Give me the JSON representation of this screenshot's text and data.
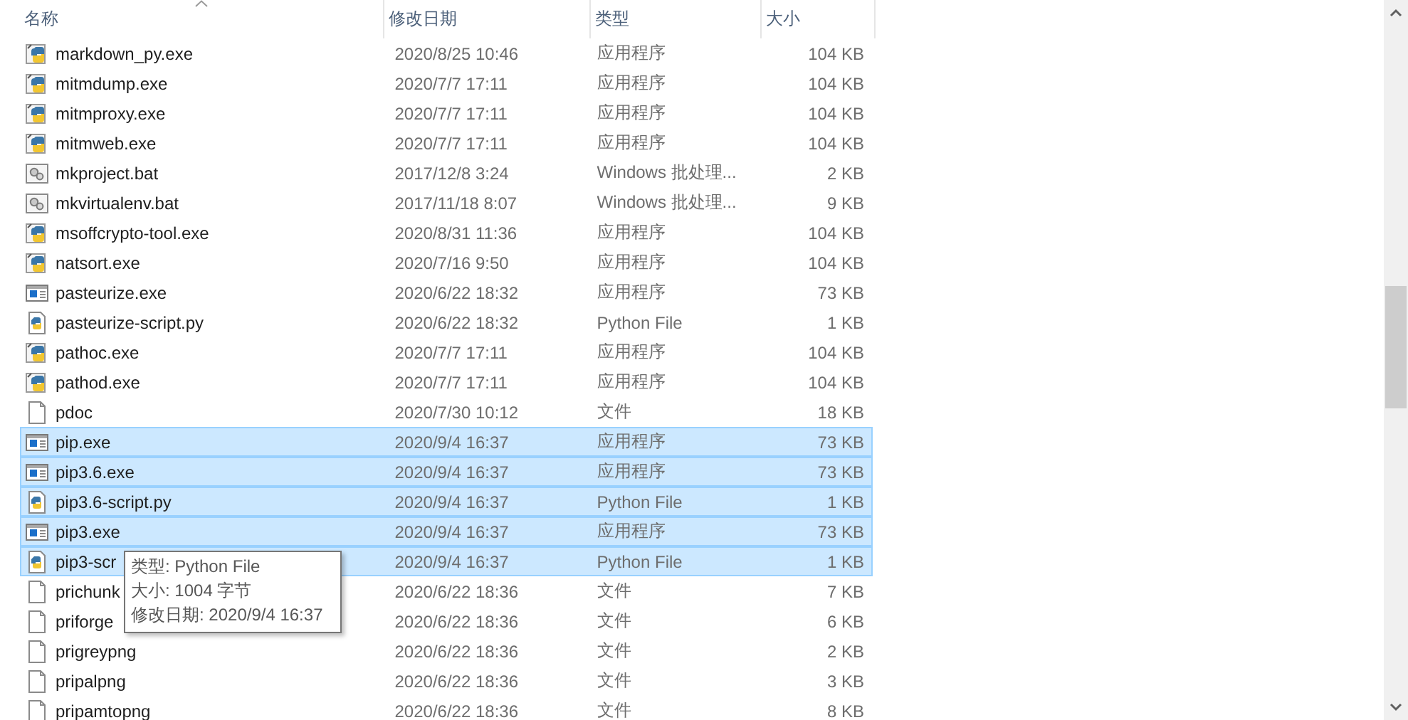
{
  "columns": [
    {
      "label": "名称",
      "sorted": true
    },
    {
      "label": "修改日期",
      "sorted": false
    },
    {
      "label": "类型",
      "sorted": false
    },
    {
      "label": "大小",
      "sorted": false
    }
  ],
  "rows": [
    {
      "kind": "pyapp",
      "name": "markdown_py.exe",
      "date": "2020/8/25 10:46",
      "type": "应用程序",
      "size": "104 KB",
      "selected": false
    },
    {
      "kind": "pyapp",
      "name": "mitmdump.exe",
      "date": "2020/7/7 17:11",
      "type": "应用程序",
      "size": "104 KB",
      "selected": false
    },
    {
      "kind": "pyapp",
      "name": "mitmproxy.exe",
      "date": "2020/7/7 17:11",
      "type": "应用程序",
      "size": "104 KB",
      "selected": false
    },
    {
      "kind": "pyapp",
      "name": "mitmweb.exe",
      "date": "2020/7/7 17:11",
      "type": "应用程序",
      "size": "104 KB",
      "selected": false
    },
    {
      "kind": "bat",
      "name": "mkproject.bat",
      "date": "2017/12/8 3:24",
      "type": "Windows 批处理...",
      "size": "2 KB",
      "selected": false
    },
    {
      "kind": "bat",
      "name": "mkvirtualenv.bat",
      "date": "2017/11/18 8:07",
      "type": "Windows 批处理...",
      "size": "9 KB",
      "selected": false
    },
    {
      "kind": "pyapp",
      "name": "msoffcrypto-tool.exe",
      "date": "2020/8/31 11:36",
      "type": "应用程序",
      "size": "104 KB",
      "selected": false
    },
    {
      "kind": "pyapp",
      "name": "natsort.exe",
      "date": "2020/7/16 9:50",
      "type": "应用程序",
      "size": "104 KB",
      "selected": false
    },
    {
      "kind": "exe",
      "name": "pasteurize.exe",
      "date": "2020/6/22 18:32",
      "type": "应用程序",
      "size": "73 KB",
      "selected": false
    },
    {
      "kind": "pyscript",
      "name": "pasteurize-script.py",
      "date": "2020/6/22 18:32",
      "type": "Python File",
      "size": "1 KB",
      "selected": false
    },
    {
      "kind": "pyapp",
      "name": "pathoc.exe",
      "date": "2020/7/7 17:11",
      "type": "应用程序",
      "size": "104 KB",
      "selected": false
    },
    {
      "kind": "pyapp",
      "name": "pathod.exe",
      "date": "2020/7/7 17:11",
      "type": "应用程序",
      "size": "104 KB",
      "selected": false
    },
    {
      "kind": "file",
      "name": "pdoc",
      "date": "2020/7/30 10:12",
      "type": "文件",
      "size": "18 KB",
      "selected": false
    },
    {
      "kind": "exe",
      "name": "pip.exe",
      "date": "2020/9/4 16:37",
      "type": "应用程序",
      "size": "73 KB",
      "selected": true
    },
    {
      "kind": "exe",
      "name": "pip3.6.exe",
      "date": "2020/9/4 16:37",
      "type": "应用程序",
      "size": "73 KB",
      "selected": true
    },
    {
      "kind": "pyscript",
      "name": "pip3.6-script.py",
      "date": "2020/9/4 16:37",
      "type": "Python File",
      "size": "1 KB",
      "selected": true
    },
    {
      "kind": "exe",
      "name": "pip3.exe",
      "date": "2020/9/4 16:37",
      "type": "应用程序",
      "size": "73 KB",
      "selected": true
    },
    {
      "kind": "pyscript",
      "name": "pip3-scr",
      "date": "2020/9/4 16:37",
      "type": "Python File",
      "size": "1 KB",
      "selected": true
    },
    {
      "kind": "file",
      "name": "prichunk",
      "date": "2020/6/22 18:36",
      "type": "文件",
      "size": "7 KB",
      "selected": false
    },
    {
      "kind": "file",
      "name": "priforge",
      "date": "2020/6/22 18:36",
      "type": "文件",
      "size": "6 KB",
      "selected": false
    },
    {
      "kind": "file",
      "name": "prigreypng",
      "date": "2020/6/22 18:36",
      "type": "文件",
      "size": "2 KB",
      "selected": false
    },
    {
      "kind": "file",
      "name": "pripalpng",
      "date": "2020/6/22 18:36",
      "type": "文件",
      "size": "3 KB",
      "selected": false
    },
    {
      "kind": "file",
      "name": "pripamtopng",
      "date": "2020/6/22 18:36",
      "type": "文件",
      "size": "8 KB",
      "selected": false
    }
  ],
  "tooltip": {
    "lines": [
      "类型: Python File",
      "大小: 1004 字节",
      "修改日期: 2020/9/4 16:37"
    ]
  }
}
